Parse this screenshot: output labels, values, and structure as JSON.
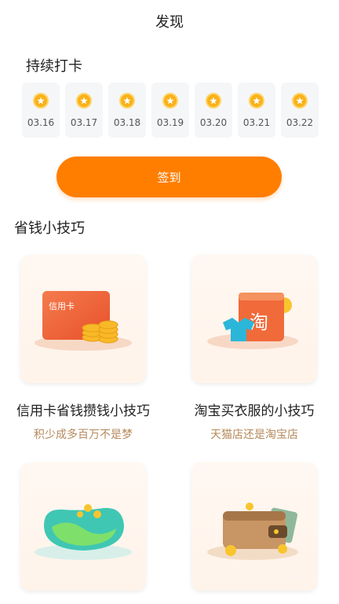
{
  "page": {
    "title": "发现"
  },
  "checkin": {
    "title": "持续打卡",
    "days": [
      {
        "date": "03.16"
      },
      {
        "date": "03.17"
      },
      {
        "date": "03.18"
      },
      {
        "date": "03.19"
      },
      {
        "date": "03.20"
      },
      {
        "date": "03.21"
      },
      {
        "date": "03.22"
      }
    ],
    "button_label": "签到"
  },
  "tips": {
    "title": "省钱小技巧",
    "cards": [
      {
        "title": "信用卡省钱攒钱小技巧",
        "subtitle": "积少成多百万不是梦",
        "icon": "credit-card-coins-icon",
        "card_text": "信用卡"
      },
      {
        "title": "淘宝买衣服的小技巧",
        "subtitle": "天猫店还是淘宝店",
        "icon": "taobao-shopping-bag-icon",
        "card_text": "淘"
      },
      {
        "title": "",
        "subtitle": "",
        "icon": "green-pot-icon"
      },
      {
        "title": "",
        "subtitle": "",
        "icon": "wallet-icon"
      }
    ]
  },
  "colors": {
    "accent": "#ff7e00",
    "coin": "#f9b21a",
    "subtitle": "#b58a5c"
  }
}
